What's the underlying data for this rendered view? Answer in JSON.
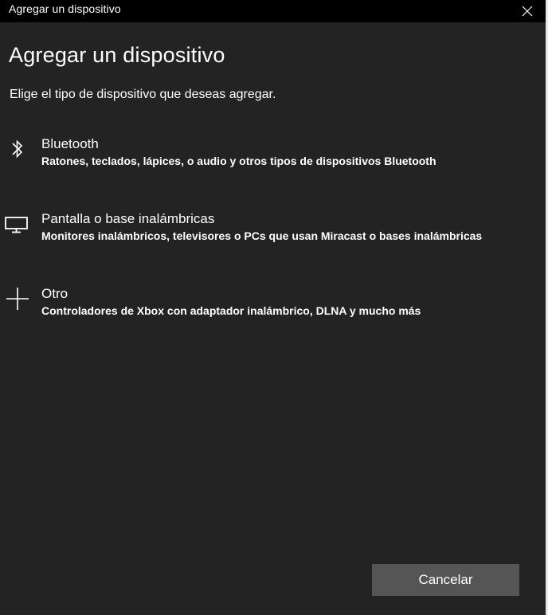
{
  "window": {
    "title": "Agregar un dispositivo",
    "close_icon": "close-icon"
  },
  "header": {
    "title": "Agregar un dispositivo",
    "subtitle": "Elige el tipo de dispositivo que deseas agregar."
  },
  "options": [
    {
      "icon": "bluetooth-icon",
      "label": "Bluetooth",
      "description": "Ratones, teclados, lápices, o audio y otros tipos de dispositivos Bluetooth"
    },
    {
      "icon": "monitor-icon",
      "label": "Pantalla o base inalámbricas",
      "description": "Monitores inalámbricos, televisores o PCs que usan Miracast o bases inalámbricas"
    },
    {
      "icon": "plus-icon",
      "label": "Otro",
      "description": "Controladores de Xbox con adaptador inalámbrico, DLNA y mucho más"
    }
  ],
  "footer": {
    "cancel_label": "Cancelar"
  },
  "colors": {
    "background": "#232323",
    "titlebar": "#000000",
    "button": "#555555",
    "text": "#ffffff"
  }
}
